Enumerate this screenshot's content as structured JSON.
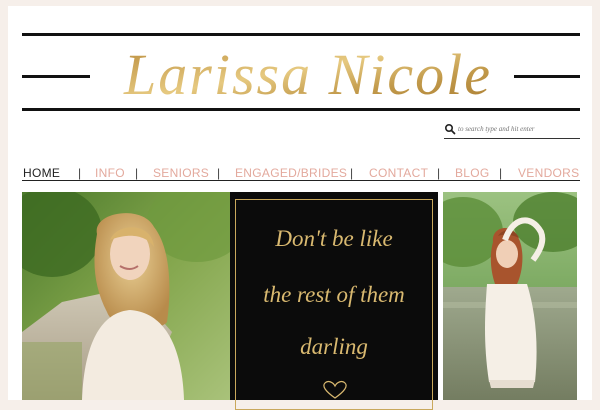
{
  "site": {
    "logo_text": "Larissa Nicole"
  },
  "search": {
    "placeholder": "to search type and hit enter",
    "icon": "search-icon"
  },
  "nav": {
    "items": [
      {
        "label": "HOME",
        "active": true
      },
      {
        "label": "INFO",
        "active": false
      },
      {
        "label": "SENIORS",
        "active": false
      },
      {
        "label": "ENGAGED/BRIDES",
        "active": false
      },
      {
        "label": "CONTACT",
        "active": false
      },
      {
        "label": "BLOG",
        "active": false
      },
      {
        "label": "VENDORS",
        "active": false
      }
    ],
    "separator": "|"
  },
  "quote": {
    "lines": [
      "Don't be like",
      "the rest of them",
      "darling"
    ],
    "icon": "heart-outline-icon"
  },
  "colors": {
    "accent": "#e3a99d",
    "gold": "#c9a85c",
    "text_dark": "#222222"
  }
}
